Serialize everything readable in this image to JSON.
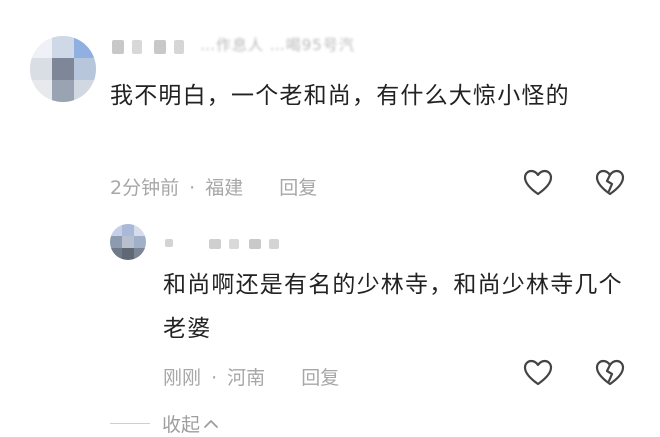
{
  "comments": [
    {
      "username": "…作息人 …喝95号汽",
      "text": "我不明白，一个老和尚，有什么大惊小怪的",
      "time": "2分钟前",
      "separator": "·",
      "location": "福建",
      "reply_label": "回复"
    },
    {
      "username": "",
      "text": "和尚啊还是有名的少林寺，和尚少林寺几个老婆",
      "time": "刚刚",
      "separator": "·",
      "location": "河南",
      "reply_label": "回复"
    }
  ],
  "collapse_label": "收起",
  "icons": {
    "like": "heart-icon",
    "dislike": "broken-heart-icon",
    "collapse": "chevron-up-icon"
  },
  "colors": {
    "text": "#222222",
    "meta": "#a7a7a7",
    "icon": "#444444"
  }
}
